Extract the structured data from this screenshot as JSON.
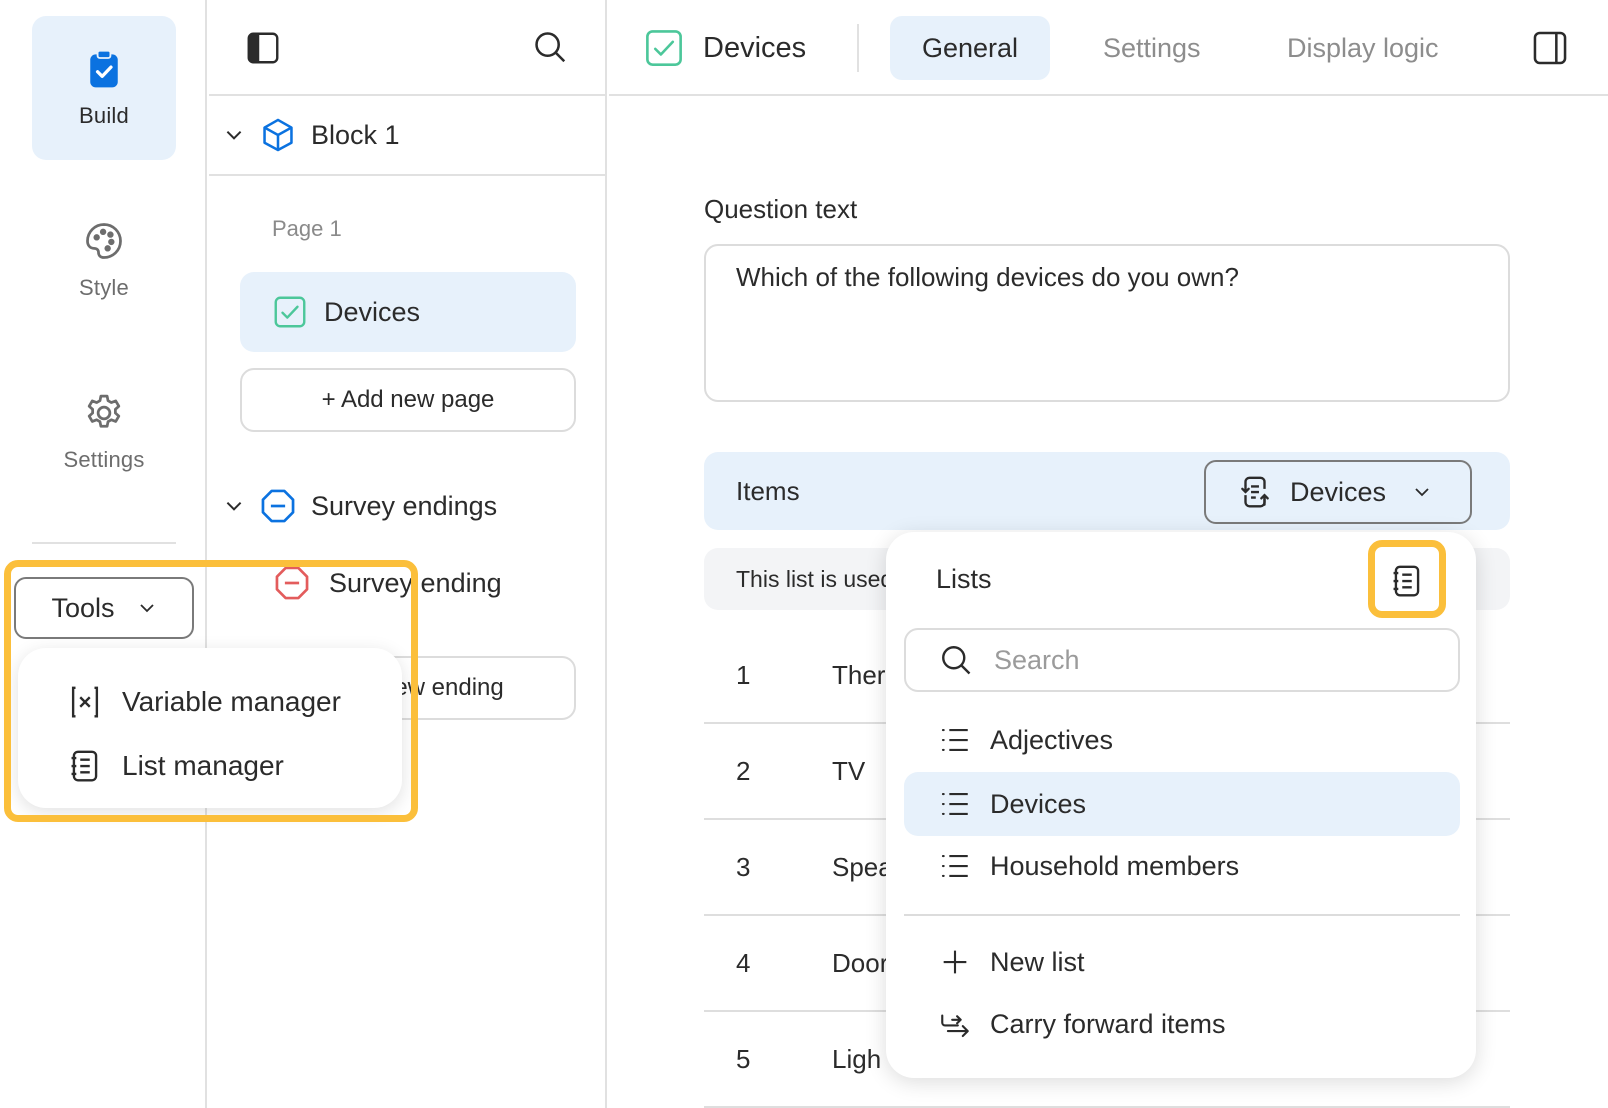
{
  "rail": {
    "items": [
      {
        "label": "Build",
        "icon": "clipboard-check-icon",
        "active": true
      },
      {
        "label": "Style",
        "icon": "palette-icon",
        "active": false
      },
      {
        "label": "Settings",
        "icon": "gear-icon",
        "active": false
      }
    ],
    "tools_label": "Tools",
    "tools_menu": [
      {
        "label": "Variable manager",
        "icon": "variable-icon"
      },
      {
        "label": "List manager",
        "icon": "list-manager-icon"
      }
    ]
  },
  "tree": {
    "block_label": "Block 1",
    "page_label": "Page 1",
    "page_item_label": "Devices",
    "add_page_label": "+ Add new page",
    "endings_label": "Survey endings",
    "ending_item_label": "Survey ending",
    "add_ending_label": "+ Add new ending"
  },
  "editor": {
    "question_title": "Devices",
    "tabs": [
      {
        "label": "General",
        "active": true
      },
      {
        "label": "Settings",
        "active": false
      },
      {
        "label": "Display logic",
        "active": false
      }
    ],
    "question_text_label": "Question text",
    "question_text_value": "Which of the following devices do you own?",
    "items_label": "Items",
    "items_list_selected": "Devices",
    "info_text": "This list is used",
    "items": [
      {
        "num": "1",
        "label": "Ther"
      },
      {
        "num": "2",
        "label": "TV"
      },
      {
        "num": "3",
        "label": "Spea"
      },
      {
        "num": "4",
        "label": "Door"
      },
      {
        "num": "5",
        "label": "Ligh"
      }
    ]
  },
  "lists_dropdown": {
    "header": "Lists",
    "search_placeholder": "Search",
    "options": [
      {
        "label": "Adjectives",
        "selected": false
      },
      {
        "label": "Devices",
        "selected": true
      },
      {
        "label": "Household members",
        "selected": false
      }
    ],
    "actions": [
      {
        "label": "New list",
        "icon": "plus-icon"
      },
      {
        "label": "Carry forward items",
        "icon": "carry-forward-icon"
      }
    ]
  },
  "colors": {
    "accent_blue": "#0b72e0",
    "active_bg": "#e7f1fb",
    "checkbox_green": "#4cc79a",
    "ending_red": "#e35c5c",
    "highlight_yellow": "#fbbf3b"
  }
}
